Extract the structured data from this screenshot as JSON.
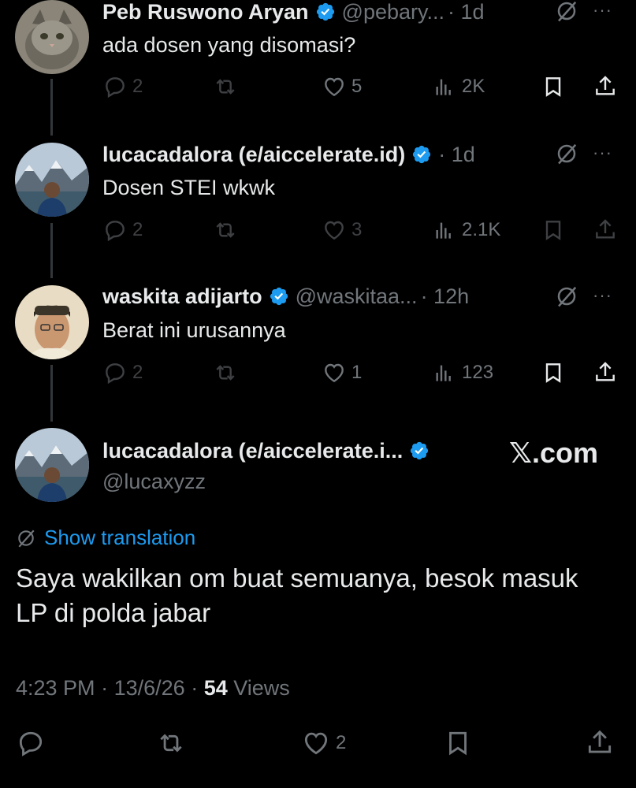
{
  "replies": [
    {
      "name": "Peb Ruswono Aryan",
      "handle": "@pebary...",
      "time": "· 1d",
      "text": "ada dosen yang disomasi?",
      "replies": "2",
      "reposts": "",
      "likes": "5",
      "views": "2K"
    },
    {
      "name": "lucacadalora (e/aiccelerate.id)",
      "handle": "",
      "time": "· 1d",
      "text": "Dosen STEI wkwk",
      "replies": "2",
      "reposts": "",
      "likes": "3",
      "views": "2.1K"
    },
    {
      "name": "waskita adijarto",
      "handle": "@waskitaa...",
      "time": "· 12h",
      "text": "Berat ini urusannya",
      "replies": "2",
      "reposts": "",
      "likes": "1",
      "views": "123"
    }
  ],
  "main": {
    "name": "lucacadalora (e/aiccelerate.i...",
    "handle": "@lucaxyzz",
    "brand": "𝕏.com",
    "show_translation": "Show translation",
    "text": "Saya wakilkan om buat semuanya, besok masuk LP di polda jabar",
    "time": "4:23 PM",
    "date": "13/6/26",
    "views_count": "54",
    "views_label": "Views",
    "likes": "2"
  },
  "icons": {
    "more": "···",
    "verified": "verified-badge-icon",
    "grok": "grok-icon"
  },
  "colors": {
    "background": "#000000",
    "text": "#e7e9ea",
    "muted": "#71767b",
    "accent": "#1d9bf0"
  }
}
